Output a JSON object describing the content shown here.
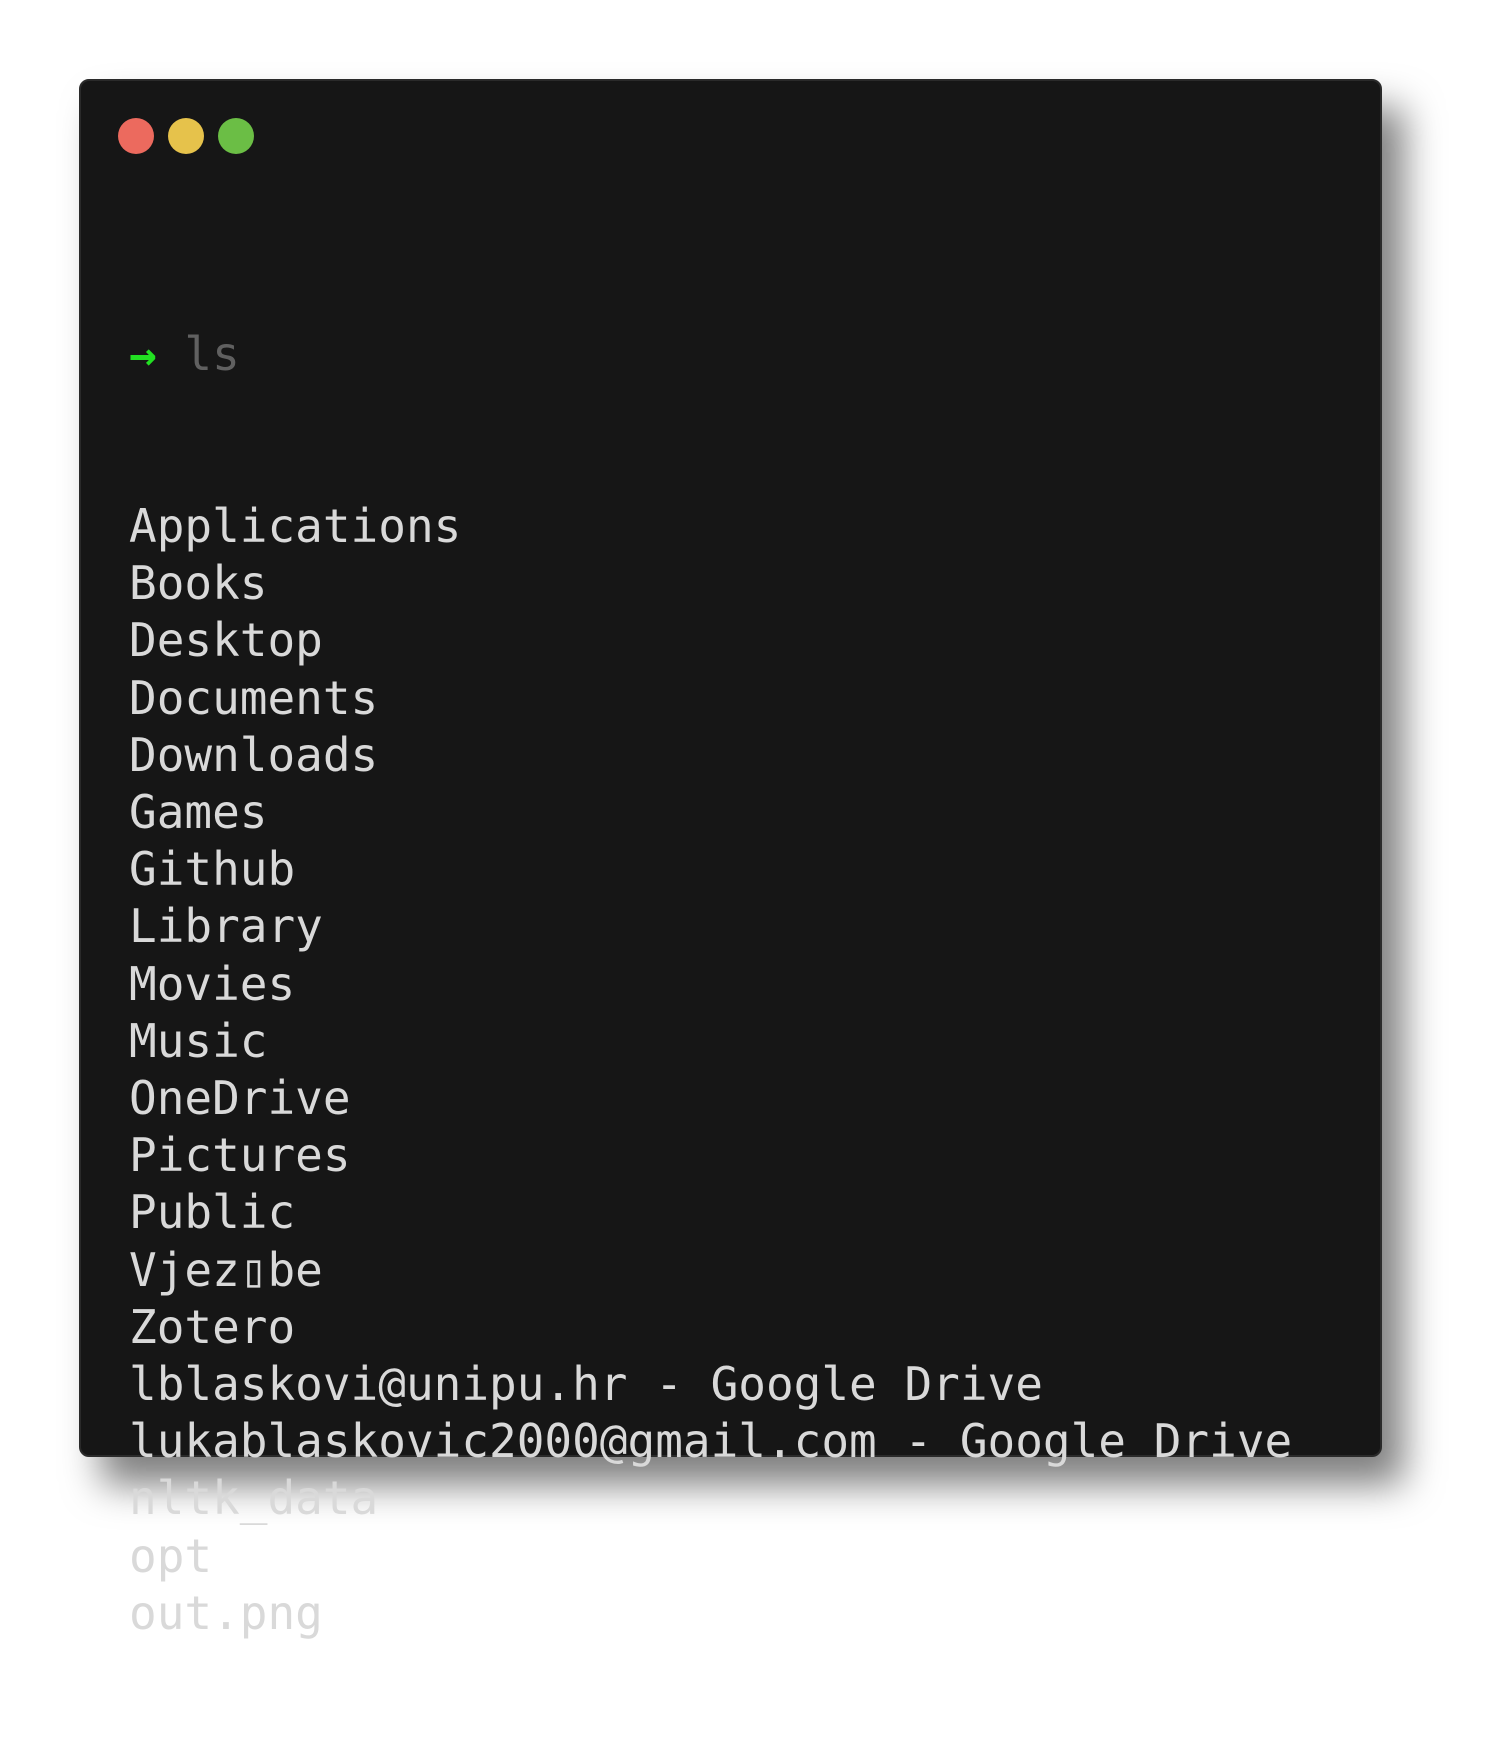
{
  "window": {
    "buttons": {
      "close_color": "#ec6a5e",
      "minimize_color": "#e6c24b",
      "maximize_color": "#6bbe45"
    }
  },
  "terminal": {
    "prompt_symbol": "→",
    "command": "ls",
    "output": [
      "Applications",
      "Books",
      "Desktop",
      "Documents",
      "Downloads",
      "Games",
      "Github",
      "Library",
      "Movies",
      "Music",
      "OneDrive",
      "Pictures",
      "Public",
      "Vjez▯be",
      "Zotero",
      "lblaskovi@unipu.hr - Google Drive",
      "lukablaskovic2000@gmail.com - Google Drive",
      "nltk_data",
      "opt",
      "out.png"
    ]
  }
}
